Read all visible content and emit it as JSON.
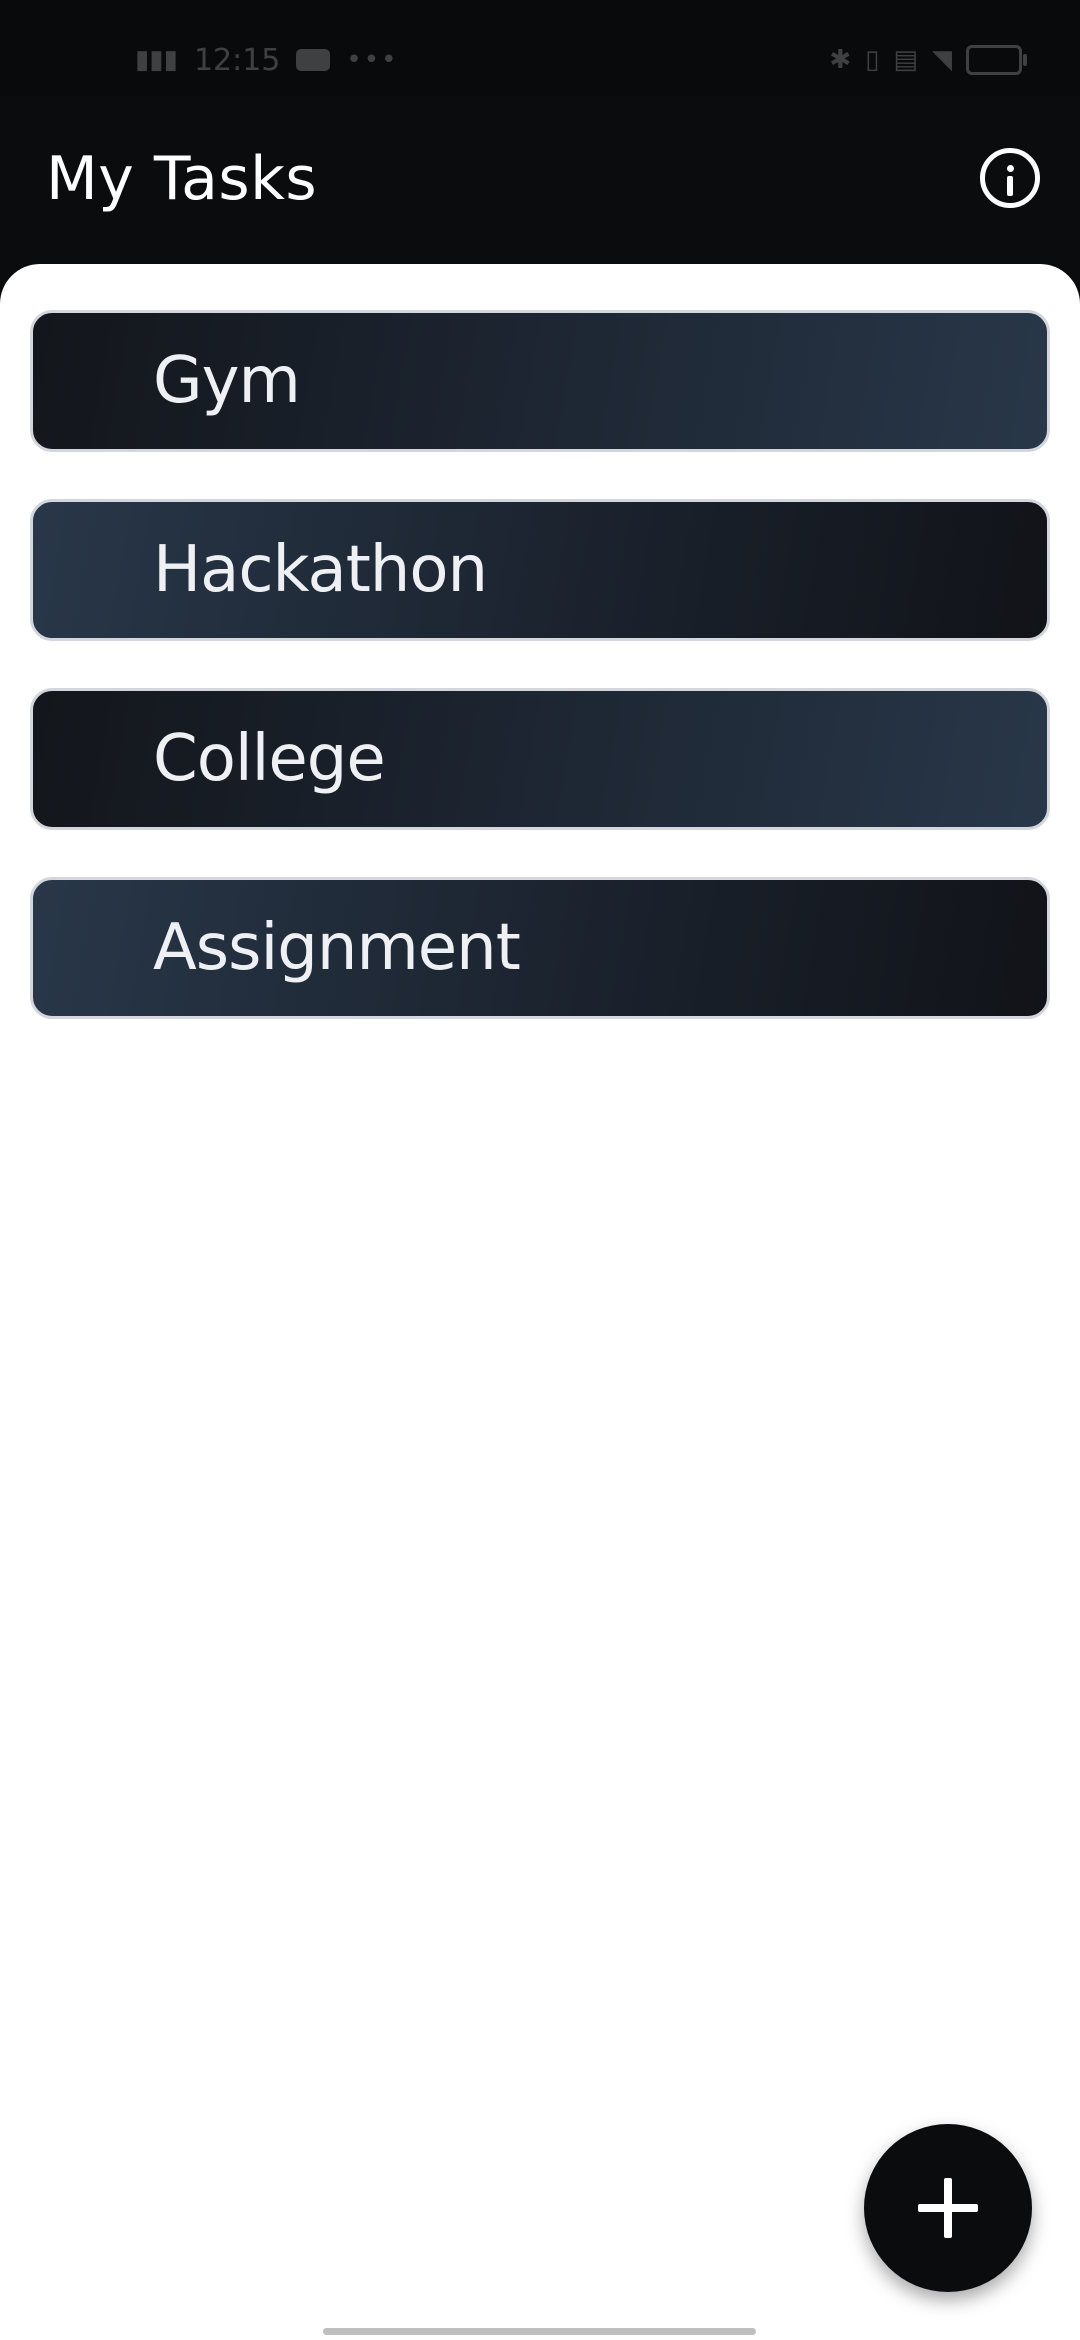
{
  "status_bar": {
    "time": "12:15"
  },
  "app_bar": {
    "title": "My Tasks",
    "info_icon": "info-icon"
  },
  "tasks": [
    {
      "label": "Gym"
    },
    {
      "label": "Hackathon"
    },
    {
      "label": "College"
    },
    {
      "label": "Assignment"
    }
  ],
  "fab": {
    "icon": "plus-icon"
  },
  "colors": {
    "background": "#0b0c0e",
    "sheet": "#ffffff",
    "card_dark": "#13161b",
    "card_light": "#283749",
    "card_border": "#d3d6dc",
    "card_text": "#eef0f3"
  }
}
